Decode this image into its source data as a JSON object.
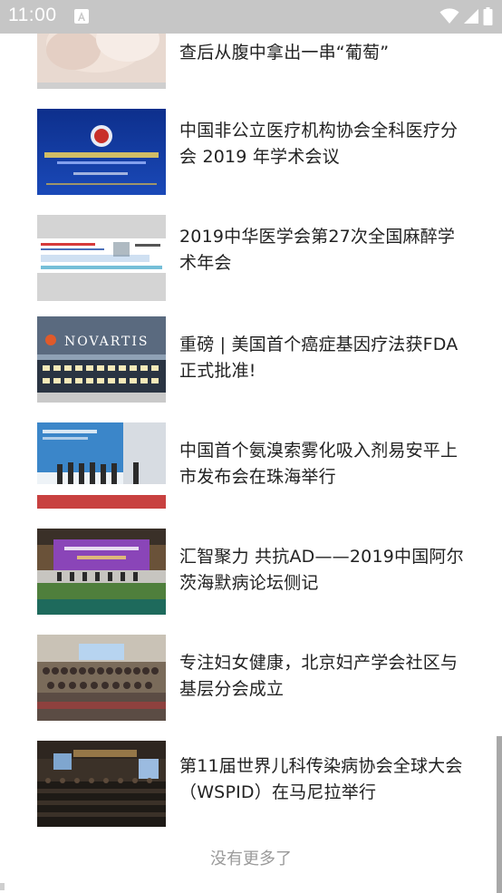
{
  "status_bar": {
    "time": "11:00",
    "notification_icon": "android-a-icon",
    "icons": [
      "wifi-icon",
      "signal-icon",
      "battery-icon"
    ]
  },
  "news_list": [
    {
      "title": "查后从腹中拿出一串“葡萄”",
      "thumbnail": "pregnant-belly-image"
    },
    {
      "title": "中国非公立医疗机构协会全科医疗分会 2019 年学术会议",
      "thumbnail": "conference-banner-image"
    },
    {
      "title": "2019中华医学会第27次全国麻醉学术年会",
      "thumbnail": "anesthesia-banner-image"
    },
    {
      "title": "重磅 | 美国首个癌症基因疗法获FDA正式批准!",
      "thumbnail": "novartis-building-image"
    },
    {
      "title": "中国首个氨溴索雾化吸入剂易安平上市发布会在珠海举行",
      "thumbnail": "launch-event-image"
    },
    {
      "title": "汇智聚力 共抗AD——2019中国阿尔茨海默病论坛侧记",
      "thumbnail": "forum-stage-image"
    },
    {
      "title": "专注妇女健康，北京妇产学会社区与基层分会成立",
      "thumbnail": "group-photo-image"
    },
    {
      "title": "第11届世界儿科传染病协会全球大会（WSPID）在马尼拉举行",
      "thumbnail": "conference-hall-image"
    }
  ],
  "footer": {
    "no_more_text": "没有更多了"
  },
  "colors": {
    "status_bar_bg": "#c6c6c6",
    "headline_text": "#222222",
    "footer_text": "#9a9a9a"
  }
}
